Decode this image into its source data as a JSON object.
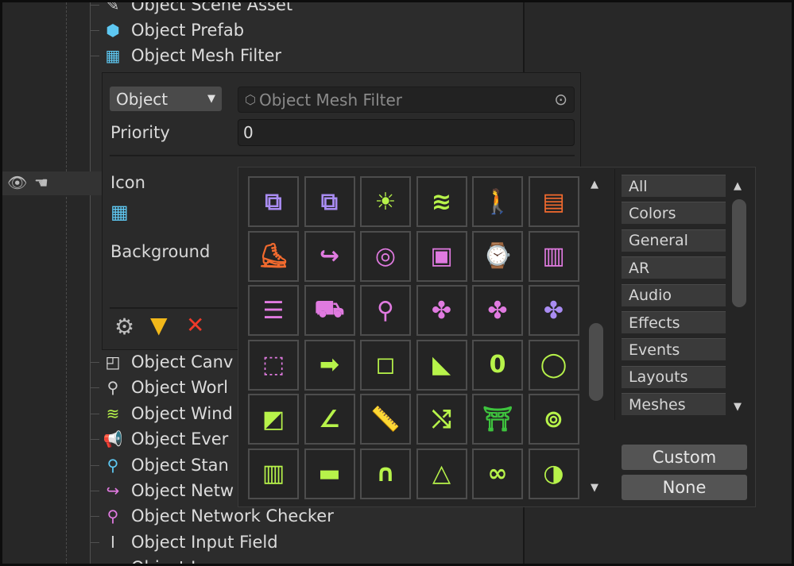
{
  "hierarchy": {
    "top_items": [
      {
        "label": "Object Scene Asset",
        "icon": "scene-asset-icon",
        "glyph": "✎",
        "color": "#cfcfcf"
      },
      {
        "label": "Object Prefab",
        "icon": "cube-icon",
        "glyph": "⬢",
        "color": "#5ec8f2"
      },
      {
        "label": "Object Mesh Filter",
        "icon": "grid-icon",
        "glyph": "▦",
        "color": "#5ec8f2"
      }
    ],
    "bottom_items": [
      {
        "label": "Object Canv",
        "icon": "canvas-icon",
        "glyph": "◰",
        "color": "#e0e0e0"
      },
      {
        "label": "Object Worl",
        "icon": "world-pin-icon",
        "glyph": "⚲",
        "color": "#cfcfcf"
      },
      {
        "label": "Object Wind",
        "icon": "wind-icon",
        "glyph": "≋",
        "color": "#b7f34a"
      },
      {
        "label": "Object Ever",
        "icon": "megaphone-icon",
        "glyph": "📢",
        "color": "#5ec8f2"
      },
      {
        "label": "Object Stan",
        "icon": "joystick-icon",
        "glyph": "⚲",
        "color": "#5ec8f2"
      },
      {
        "label": "Object Netw",
        "icon": "branch-arrow-icon",
        "glyph": "↪",
        "color": "#e07ae0"
      },
      {
        "label": "Object Network Checker",
        "icon": "location-pin-icon",
        "glyph": "⚲",
        "color": "#e07ae0"
      },
      {
        "label": "Object Input Field",
        "icon": "input-field-icon",
        "glyph": "Ⅰ",
        "color": "#d0d0d0"
      },
      {
        "label": "Object Image",
        "icon": "image-icon",
        "glyph": "▭",
        "color": "#d0d0d0"
      }
    ]
  },
  "editor": {
    "type_select": "Object",
    "object_field": "Object Mesh Filter",
    "priority_label": "Priority",
    "priority_value": "0",
    "icon_label": "Icon",
    "background_label": "Background"
  },
  "toolbar": {
    "settings": "gear-icon",
    "filter": "filter-icon",
    "remove": "close-icon"
  },
  "picker": {
    "icons": [
      [
        "⧉",
        "#a98cf2"
      ],
      [
        "⧉",
        "#a98cf2"
      ],
      [
        "☀",
        "#b7f34a"
      ],
      [
        "≋",
        "#b7f34a"
      ],
      [
        "🚶",
        "#f26a2e"
      ],
      [
        "▤",
        "#f26a2e"
      ],
      [
        "⛸",
        "#f26a2e"
      ],
      [
        "↪",
        "#e07ae0"
      ],
      [
        "◎",
        "#e07ae0"
      ],
      [
        "▣",
        "#e07ae0"
      ],
      [
        "⌚",
        "#e07ae0"
      ],
      [
        "▥",
        "#e07ae0"
      ],
      [
        "☰",
        "#e07ae0"
      ],
      [
        "⛟",
        "#e07ae0"
      ],
      [
        "⚲",
        "#e07ae0"
      ],
      [
        "✤",
        "#e07ae0"
      ],
      [
        "✤",
        "#e07ae0"
      ],
      [
        "✤",
        "#a98cf2"
      ],
      [
        "⬚",
        "#e07ae0"
      ],
      [
        "➡",
        "#b7f34a"
      ],
      [
        "◻",
        "#b7f34a"
      ],
      [
        "◣",
        "#b7f34a"
      ],
      [
        "0",
        "#b7f34a"
      ],
      [
        "◯",
        "#b7f34a"
      ],
      [
        "◩",
        "#b7f34a"
      ],
      [
        "∠",
        "#b7f34a"
      ],
      [
        "📏",
        "#b7f34a"
      ],
      [
        "⤭",
        "#b7f34a"
      ],
      [
        "⛩",
        "#3ec43e"
      ],
      [
        "⊚",
        "#b7f34a"
      ],
      [
        "▥",
        "#b7f34a"
      ],
      [
        "▬",
        "#b7f34a"
      ],
      [
        "∩",
        "#b7f34a"
      ],
      [
        "△",
        "#b7f34a"
      ],
      [
        "∞",
        "#b7f34a"
      ],
      [
        "◑",
        "#b7f34a"
      ]
    ],
    "categories": [
      "All",
      "Colors",
      "General",
      "AR",
      "Audio",
      "Effects",
      "Events",
      "Layouts",
      "Meshes"
    ],
    "custom_button": "Custom",
    "none_button": "None"
  }
}
